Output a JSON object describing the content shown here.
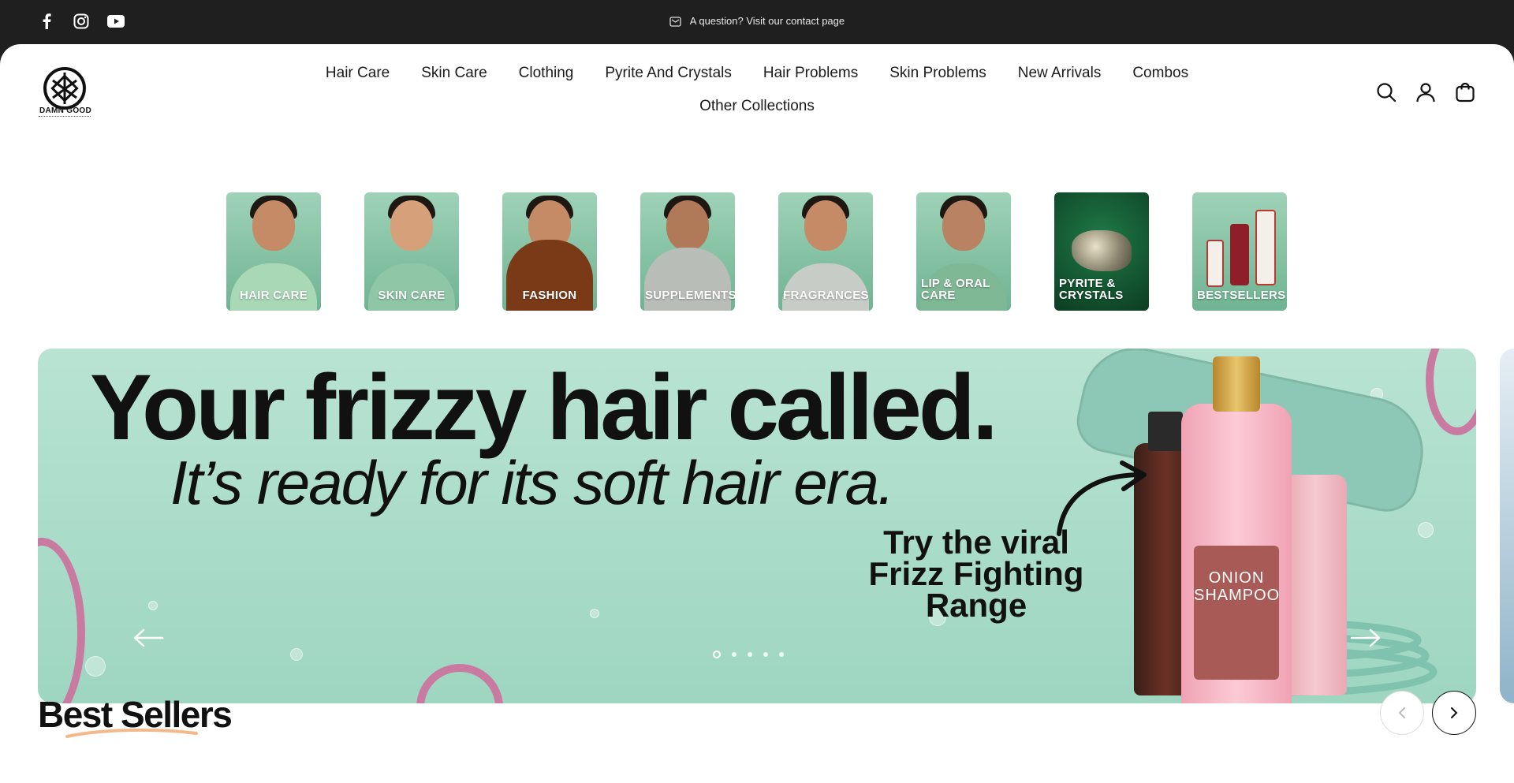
{
  "announcement": {
    "text": "A question? Visit our contact page"
  },
  "social": [
    "facebook-icon",
    "instagram-icon",
    "youtube-icon"
  ],
  "brand": {
    "logo_text": "DAMN GOOD"
  },
  "nav": {
    "items": [
      "Hair Care",
      "Skin Care",
      "Clothing",
      "Pyrite And Crystals",
      "Hair Problems",
      "Skin Problems",
      "New Arrivals",
      "Combos",
      "Other Collections"
    ]
  },
  "header_icons": [
    "search-icon",
    "account-icon",
    "cart-icon"
  ],
  "categories": [
    {
      "label": "HAIR CARE",
      "bg": "#7fbf9e"
    },
    {
      "label": "SKIN CARE",
      "bg": "#7fbf9e"
    },
    {
      "label": "FASHION",
      "bg": "#7fbf9e"
    },
    {
      "label": "SUPPLEMENTS",
      "bg": "#7fbf9e"
    },
    {
      "label": "FRAGRANCES",
      "bg": "#7fbf9e"
    },
    {
      "label": "LIP & ORAL CARE",
      "bg": "#7fbf9e"
    },
    {
      "label": "PYRITE & CRYSTALS",
      "bg": "#0f4d2c"
    },
    {
      "label": "BESTSELLERS",
      "bg": "#7fbf9e"
    }
  ],
  "hero": {
    "headline": "Your frizzy hair called.",
    "subheadline": "It’s ready for its soft hair era.",
    "callout": "Try the viral Frizz Fighting Range",
    "product_label": "ONION SHAMPOO",
    "slide_count": 5,
    "active_slide": 1
  },
  "best_sellers": {
    "title": "Best Sellers"
  },
  "colors": {
    "topbar": "#1f1f1f",
    "hero_bg": "#b3e0cf",
    "accent_underline": "#f4b98a"
  }
}
